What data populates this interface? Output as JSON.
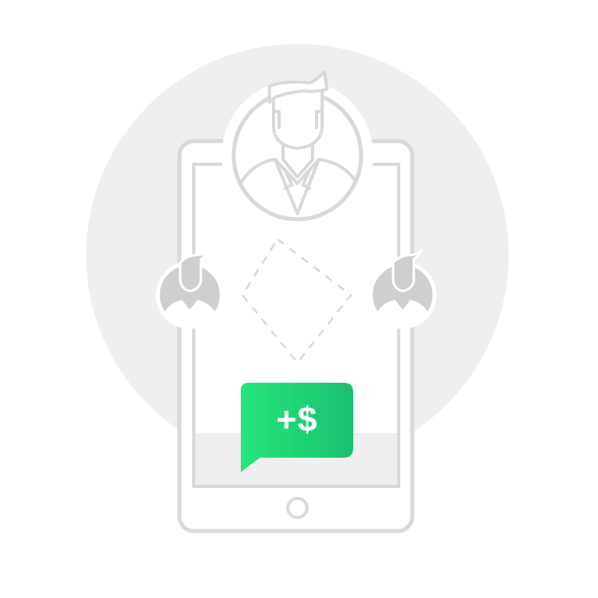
{
  "bubble": {
    "text": "+$"
  },
  "colors": {
    "circle_background": "#efeff0",
    "outline": "#d9d9d9",
    "person_fill": "#cfcfcf",
    "bubble_gradient_start": "#27e67a",
    "bubble_gradient_end": "#18c070",
    "bubble_text": "#ffffff"
  },
  "icons": [
    "phone-icon",
    "businessman-avatar-icon",
    "person-avatar-icon",
    "money-bubble-icon"
  ]
}
